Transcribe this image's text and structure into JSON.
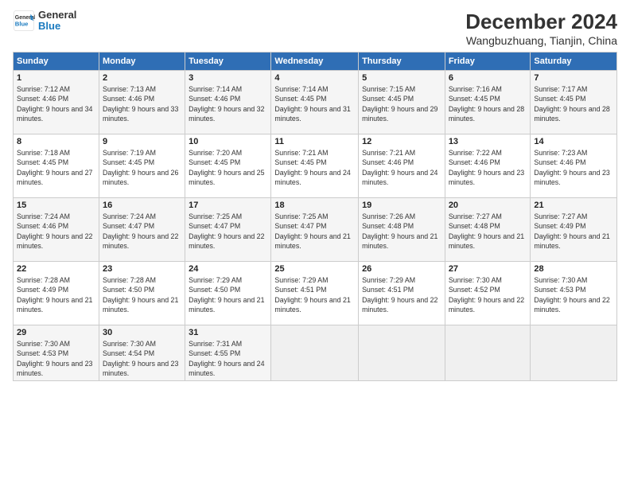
{
  "header": {
    "logo_line1": "General",
    "logo_line2": "Blue",
    "title": "December 2024",
    "subtitle": "Wangbuzhuang, Tianjin, China"
  },
  "days_of_week": [
    "Sunday",
    "Monday",
    "Tuesday",
    "Wednesday",
    "Thursday",
    "Friday",
    "Saturday"
  ],
  "weeks": [
    [
      {
        "day": 1,
        "sunrise": "7:12 AM",
        "sunset": "4:46 PM",
        "daylight": "9 hours and 34 minutes."
      },
      {
        "day": 2,
        "sunrise": "7:13 AM",
        "sunset": "4:46 PM",
        "daylight": "9 hours and 33 minutes."
      },
      {
        "day": 3,
        "sunrise": "7:14 AM",
        "sunset": "4:46 PM",
        "daylight": "9 hours and 32 minutes."
      },
      {
        "day": 4,
        "sunrise": "7:14 AM",
        "sunset": "4:45 PM",
        "daylight": "9 hours and 31 minutes."
      },
      {
        "day": 5,
        "sunrise": "7:15 AM",
        "sunset": "4:45 PM",
        "daylight": "9 hours and 29 minutes."
      },
      {
        "day": 6,
        "sunrise": "7:16 AM",
        "sunset": "4:45 PM",
        "daylight": "9 hours and 28 minutes."
      },
      {
        "day": 7,
        "sunrise": "7:17 AM",
        "sunset": "4:45 PM",
        "daylight": "9 hours and 28 minutes."
      }
    ],
    [
      {
        "day": 8,
        "sunrise": "7:18 AM",
        "sunset": "4:45 PM",
        "daylight": "9 hours and 27 minutes."
      },
      {
        "day": 9,
        "sunrise": "7:19 AM",
        "sunset": "4:45 PM",
        "daylight": "9 hours and 26 minutes."
      },
      {
        "day": 10,
        "sunrise": "7:20 AM",
        "sunset": "4:45 PM",
        "daylight": "9 hours and 25 minutes."
      },
      {
        "day": 11,
        "sunrise": "7:21 AM",
        "sunset": "4:45 PM",
        "daylight": "9 hours and 24 minutes."
      },
      {
        "day": 12,
        "sunrise": "7:21 AM",
        "sunset": "4:46 PM",
        "daylight": "9 hours and 24 minutes."
      },
      {
        "day": 13,
        "sunrise": "7:22 AM",
        "sunset": "4:46 PM",
        "daylight": "9 hours and 23 minutes."
      },
      {
        "day": 14,
        "sunrise": "7:23 AM",
        "sunset": "4:46 PM",
        "daylight": "9 hours and 23 minutes."
      }
    ],
    [
      {
        "day": 15,
        "sunrise": "7:24 AM",
        "sunset": "4:46 PM",
        "daylight": "9 hours and 22 minutes."
      },
      {
        "day": 16,
        "sunrise": "7:24 AM",
        "sunset": "4:47 PM",
        "daylight": "9 hours and 22 minutes."
      },
      {
        "day": 17,
        "sunrise": "7:25 AM",
        "sunset": "4:47 PM",
        "daylight": "9 hours and 22 minutes."
      },
      {
        "day": 18,
        "sunrise": "7:25 AM",
        "sunset": "4:47 PM",
        "daylight": "9 hours and 21 minutes."
      },
      {
        "day": 19,
        "sunrise": "7:26 AM",
        "sunset": "4:48 PM",
        "daylight": "9 hours and 21 minutes."
      },
      {
        "day": 20,
        "sunrise": "7:27 AM",
        "sunset": "4:48 PM",
        "daylight": "9 hours and 21 minutes."
      },
      {
        "day": 21,
        "sunrise": "7:27 AM",
        "sunset": "4:49 PM",
        "daylight": "9 hours and 21 minutes."
      }
    ],
    [
      {
        "day": 22,
        "sunrise": "7:28 AM",
        "sunset": "4:49 PM",
        "daylight": "9 hours and 21 minutes."
      },
      {
        "day": 23,
        "sunrise": "7:28 AM",
        "sunset": "4:50 PM",
        "daylight": "9 hours and 21 minutes."
      },
      {
        "day": 24,
        "sunrise": "7:29 AM",
        "sunset": "4:50 PM",
        "daylight": "9 hours and 21 minutes."
      },
      {
        "day": 25,
        "sunrise": "7:29 AM",
        "sunset": "4:51 PM",
        "daylight": "9 hours and 21 minutes."
      },
      {
        "day": 26,
        "sunrise": "7:29 AM",
        "sunset": "4:51 PM",
        "daylight": "9 hours and 22 minutes."
      },
      {
        "day": 27,
        "sunrise": "7:30 AM",
        "sunset": "4:52 PM",
        "daylight": "9 hours and 22 minutes."
      },
      {
        "day": 28,
        "sunrise": "7:30 AM",
        "sunset": "4:53 PM",
        "daylight": "9 hours and 22 minutes."
      }
    ],
    [
      {
        "day": 29,
        "sunrise": "7:30 AM",
        "sunset": "4:53 PM",
        "daylight": "9 hours and 23 minutes."
      },
      {
        "day": 30,
        "sunrise": "7:30 AM",
        "sunset": "4:54 PM",
        "daylight": "9 hours and 23 minutes."
      },
      {
        "day": 31,
        "sunrise": "7:31 AM",
        "sunset": "4:55 PM",
        "daylight": "9 hours and 24 minutes."
      },
      null,
      null,
      null,
      null
    ]
  ]
}
